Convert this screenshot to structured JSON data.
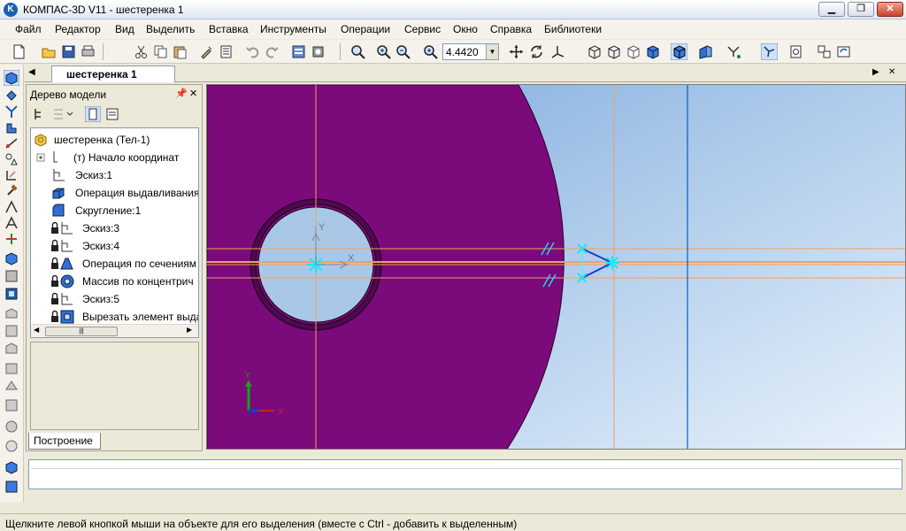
{
  "window": {
    "title": "КОМПАС-3D V11 - шестеренка 1",
    "app_icon": "kompas-logo-icon"
  },
  "menu": [
    "Файл",
    "Редактор",
    "Вид",
    "Выделить",
    "Вставка",
    "Инструменты",
    "Операции",
    "Сервис",
    "Окно",
    "Справка",
    "Библиотеки"
  ],
  "toolbar": {
    "zoom_value": "4.4420"
  },
  "document": {
    "tab_label": "шестеренка 1"
  },
  "model_tree": {
    "title": "Дерево модели",
    "items": [
      {
        "label": "шестеренка (Тел-1)",
        "icon": "part-icon"
      },
      {
        "label": "(т) Начало координат",
        "icon": "origin-icon"
      },
      {
        "label": "Эскиз:1",
        "icon": "sketch-icon"
      },
      {
        "label": "Операция выдавливания",
        "icon": "extrude-icon"
      },
      {
        "label": "Скругление:1",
        "icon": "fillet-icon"
      },
      {
        "label": "Эскиз:3",
        "icon": "sketch-icon"
      },
      {
        "label": "Эскиз:4",
        "icon": "sketch-icon"
      },
      {
        "label": "Операция по сечениям",
        "icon": "loft-icon"
      },
      {
        "label": "Массив по концентрич",
        "icon": "array-icon"
      },
      {
        "label": "Эскиз:5",
        "icon": "sketch-icon"
      },
      {
        "label": "Вырезать элемент выда",
        "icon": "cut-extrude-icon"
      }
    ],
    "panel_tab": "Построение"
  },
  "viewport": {
    "axis_labels": {
      "x": "X",
      "y": "Y"
    },
    "colors": {
      "part": "#7b0a7b",
      "background": "#a9c8e8",
      "construction": "#f0a060",
      "sketch": "#19e6ff",
      "axis": "#0a5cc8"
    }
  },
  "status": {
    "hint": "Щелкните левой кнопкой мыши на объекте для его выделения (вместе с Ctrl - добавить к выделенным)"
  }
}
